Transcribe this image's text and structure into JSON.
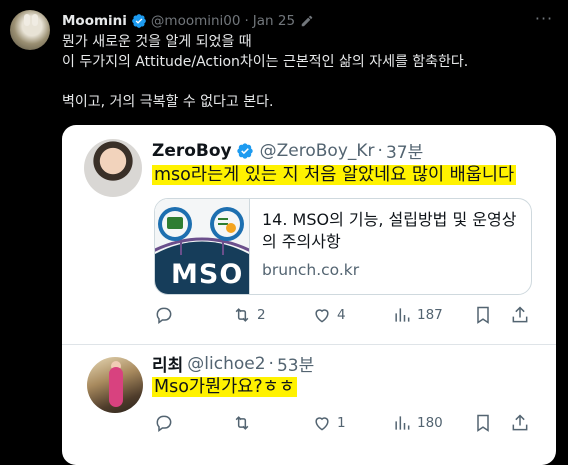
{
  "tweet": {
    "author_name": "Moomini",
    "handle": "@moomini00",
    "separator": "·",
    "date": "Jan 25",
    "lines": [
      "뭔가 새로운 것을 알게 되었을 때",
      "이 두가지의 Attitude/Action차이는 근본적인 삶의 자세를 함축한다.",
      "벽이고, 거의 극복할 수 없다고 본다."
    ]
  },
  "quoted": {
    "author_name": "ZeroBoy",
    "handle": "@ZeroBoy_Kr",
    "separator": "·",
    "time": "37분",
    "text": "mso라는게 있는 지 처음 알았네요 많이 배웁니다",
    "link_card": {
      "thumb_label": "MSO",
      "title": "14. MSO의 기능, 설립방법 및 운영상의 주의사항",
      "domain": "brunch.co.kr"
    },
    "stats": {
      "replies": "",
      "retweets": "2",
      "likes": "4",
      "views": "187"
    }
  },
  "reply": {
    "author_name": "리최",
    "handle": "@lichoe2",
    "separator": "·",
    "time": "53분",
    "text": "Mso가뭔가요?ㅎㅎ",
    "stats": {
      "replies": "",
      "retweets": "",
      "likes": "1",
      "views": "180"
    }
  },
  "colors": {
    "background": "#000000",
    "text": "#e7e9ea",
    "muted": "#71767b",
    "verified": "#1d9bf0",
    "highlight": "#fff200",
    "card_bg": "#ffffff",
    "mso_thumb_dark": "#163d5a"
  },
  "icons": {
    "verified": "verified-badge-icon",
    "edit": "pencil-edit-icon",
    "more": "more-dots-icon",
    "reply": "reply-bubble-icon",
    "retweet": "retweet-icon",
    "like": "heart-icon",
    "views": "views-bar-chart-icon",
    "bookmark": "bookmark-icon",
    "share": "share-upload-icon"
  }
}
